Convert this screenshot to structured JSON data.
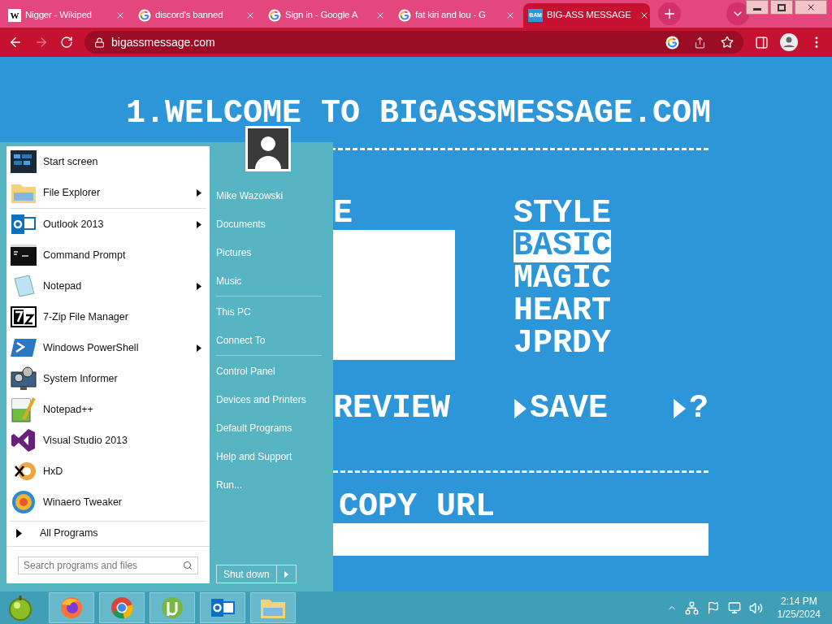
{
  "browser": {
    "tabs": [
      {
        "title": "Nigger - Wikiped",
        "favicon_text": "W",
        "selected": false
      },
      {
        "title": "discord's banned",
        "selected": false
      },
      {
        "title": "Sign in - Google A",
        "selected": false
      },
      {
        "title": "fat kiri and lou - G",
        "selected": false
      },
      {
        "title": "BIG-ASS MESSAGE",
        "favicon_text": "BAM",
        "selected": true
      }
    ],
    "nav": {
      "back_enabled": true,
      "forward_enabled": false
    },
    "address": "bigassmessage.com"
  },
  "page": {
    "title": "1.WELCOME TO BIGASSMESSAGE.COM",
    "message_heading": "E",
    "style_heading": "STYLE",
    "styles": [
      {
        "label": "BASIC",
        "selected": true
      },
      {
        "label": "MAGIC",
        "selected": false
      },
      {
        "label": "HEART",
        "selected": false
      },
      {
        "label": "JPRDY",
        "selected": false
      }
    ],
    "preview": "REVIEW",
    "actions": [
      "SAVE",
      "?"
    ],
    "copy_label": "COPY URL"
  },
  "start_menu": {
    "programs": [
      {
        "label": "Start screen",
        "submenu": false
      },
      {
        "label": "File Explorer",
        "submenu": true
      },
      {
        "label": "Outlook 2013",
        "submenu": true
      },
      {
        "label": "Command Prompt",
        "submenu": false
      },
      {
        "label": "Notepad",
        "submenu": true
      },
      {
        "label": "7-Zip File Manager",
        "submenu": false
      },
      {
        "label": "Windows PowerShell",
        "submenu": true
      },
      {
        "label": "System Informer",
        "submenu": false
      },
      {
        "label": "Notepad++",
        "submenu": false
      },
      {
        "label": "Visual Studio 2013",
        "submenu": false
      },
      {
        "label": "HxD",
        "submenu": false
      },
      {
        "label": "Winaero Tweaker",
        "submenu": false
      }
    ],
    "all_programs": "All Programs",
    "search_placeholder": "Search programs and files",
    "user_name": "Mike Wazowski",
    "places": [
      [
        "Documents",
        "Pictures",
        "Music"
      ],
      [
        "This PC",
        "Connect To"
      ],
      [
        "Control Panel",
        "Devices and Printers",
        "Default Programs",
        "Help and Support",
        "Run..."
      ]
    ],
    "shutdown": "Shut down"
  },
  "taskbar": {
    "time": "2:14 PM",
    "date": "1/25/2024"
  }
}
